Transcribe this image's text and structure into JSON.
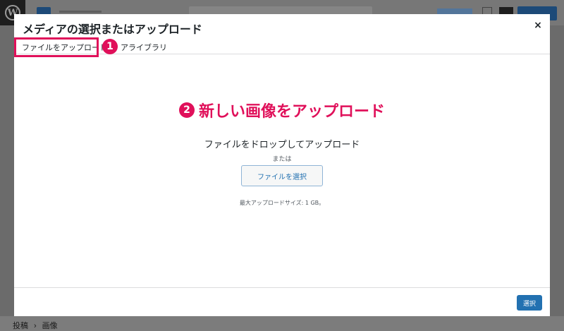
{
  "background": {
    "wp_logo": "W",
    "breadcrumb": [
      "投稿",
      "画像"
    ],
    "breadcrumb_separator": "›"
  },
  "modal": {
    "title": "メディアの選択またはアップロード",
    "close_icon": "×",
    "tabs": [
      {
        "label": "ファイルをアップロード",
        "active": true
      },
      {
        "label": "アライブラリ",
        "active": false
      }
    ],
    "annotations": {
      "badge_1": "1",
      "badge_2": "2",
      "step_2_text": "新しい画像をアップロード"
    },
    "upload": {
      "instructions": "ファイルをドロップしてアップロード",
      "or": "または",
      "select_files_label": "ファイルを選択",
      "max_size": "最大アップロードサイズ: 1 GB。"
    },
    "toolbar": {
      "select_label": "選択"
    }
  },
  "colors": {
    "accent": "#2271b1",
    "annotation": "#e0105a"
  }
}
